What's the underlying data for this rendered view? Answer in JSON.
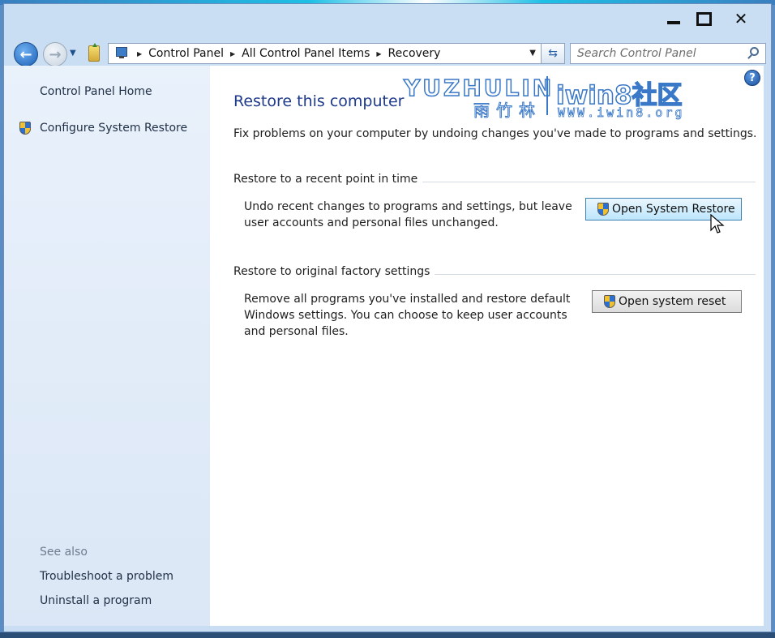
{
  "window": {
    "controls": {
      "minimize": "minimize",
      "maximize": "maximize",
      "close": "close"
    }
  },
  "navigation": {
    "breadcrumbs": [
      "Control Panel",
      "All Control Panel Items",
      "Recovery"
    ],
    "search_placeholder": "Search Control Panel"
  },
  "sidebar": {
    "home_link": "Control Panel Home",
    "configure_link": "Configure System Restore",
    "see_also_heading": "See also",
    "see_also_links": [
      "Troubleshoot a problem",
      "Uninstall a program"
    ]
  },
  "main": {
    "title": "Restore this computer",
    "intro": "Fix problems on your computer by undoing changes you've made to programs and settings.",
    "sections": [
      {
        "heading": "Restore to a recent point in time",
        "description": "Undo recent changes to programs and settings, but leave user accounts and personal files unchanged.",
        "button": "Open System Restore"
      },
      {
        "heading": "Restore to original factory settings",
        "description": "Remove all programs you've installed and restore default Windows settings. You can choose to keep user accounts and personal files.",
        "button": "Open system reset"
      }
    ]
  },
  "watermark": {
    "latin": "YUZHULIN",
    "chinese": "雨竹林",
    "brand": "iwin8社区",
    "url": "WWW.iwin8.org"
  },
  "colors": {
    "window_frame": "#c9def3",
    "sidebar_bg": "#e3edf9",
    "title_blue": "#1e3a8a",
    "button_hover": "#bde6fd"
  }
}
